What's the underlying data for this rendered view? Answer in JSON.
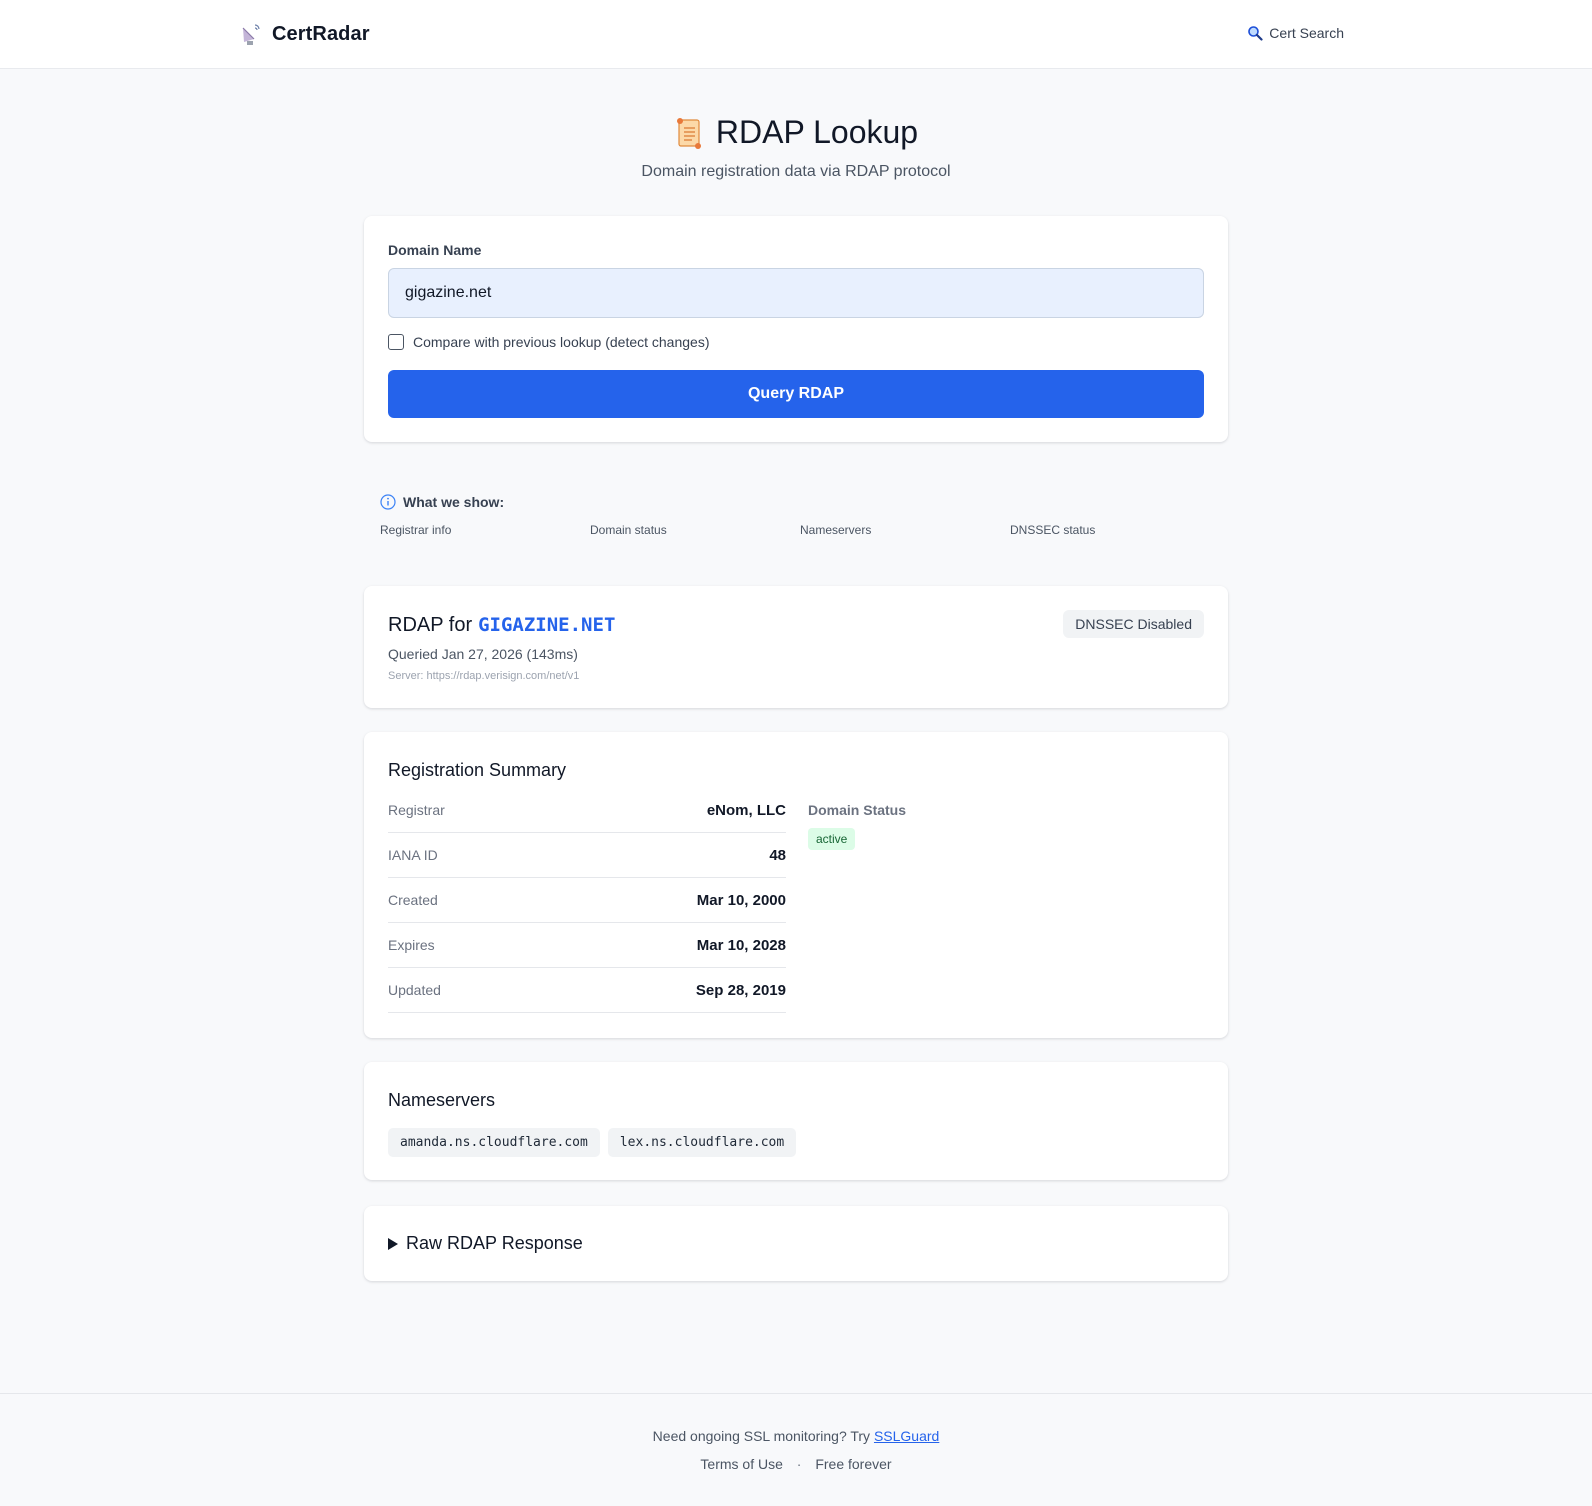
{
  "header": {
    "brand": "CertRadar",
    "nav_link": "Cert Search"
  },
  "hero": {
    "title": "RDAP Lookup",
    "subtitle": "Domain registration data via RDAP protocol"
  },
  "search": {
    "label": "Domain Name",
    "value": "gigazine.net",
    "compare_label": "Compare with previous lookup (detect changes)",
    "compare_checked": false,
    "button": "Query RDAP"
  },
  "info": {
    "heading": "What we show:",
    "items": [
      "Registrar info",
      "Domain status",
      "Nameservers",
      "DNSSEC status"
    ]
  },
  "result": {
    "title_prefix": "RDAP for",
    "domain": "GIGAZINE.NET",
    "queried": "Queried Jan 27, 2026 (143ms)",
    "server": "Server: https://rdap.verisign.com/net/v1",
    "dnssec_badge": "DNSSEC Disabled"
  },
  "summary": {
    "title": "Registration Summary",
    "rows": [
      {
        "key": "Registrar",
        "value": "eNom, LLC"
      },
      {
        "key": "IANA ID",
        "value": "48"
      },
      {
        "key": "Created",
        "value": "Mar 10, 2000"
      },
      {
        "key": "Expires",
        "value": "Mar 10, 2028"
      },
      {
        "key": "Updated",
        "value": "Sep 28, 2019"
      }
    ],
    "status_label": "Domain Status",
    "status_value": "active"
  },
  "nameservers": {
    "title": "Nameservers",
    "items": [
      "amanda.ns.cloudflare.com",
      "lex.ns.cloudflare.com"
    ]
  },
  "raw": {
    "title": "Raw RDAP Response"
  },
  "footer": {
    "prompt": "Need ongoing SSL monitoring? Try",
    "link": "SSLGuard",
    "terms": "Terms of Use",
    "separator": "·",
    "free": "Free forever"
  },
  "colors": {
    "accent": "#2563eb",
    "status_active_bg": "#dcfce7",
    "status_active_text": "#166534"
  }
}
